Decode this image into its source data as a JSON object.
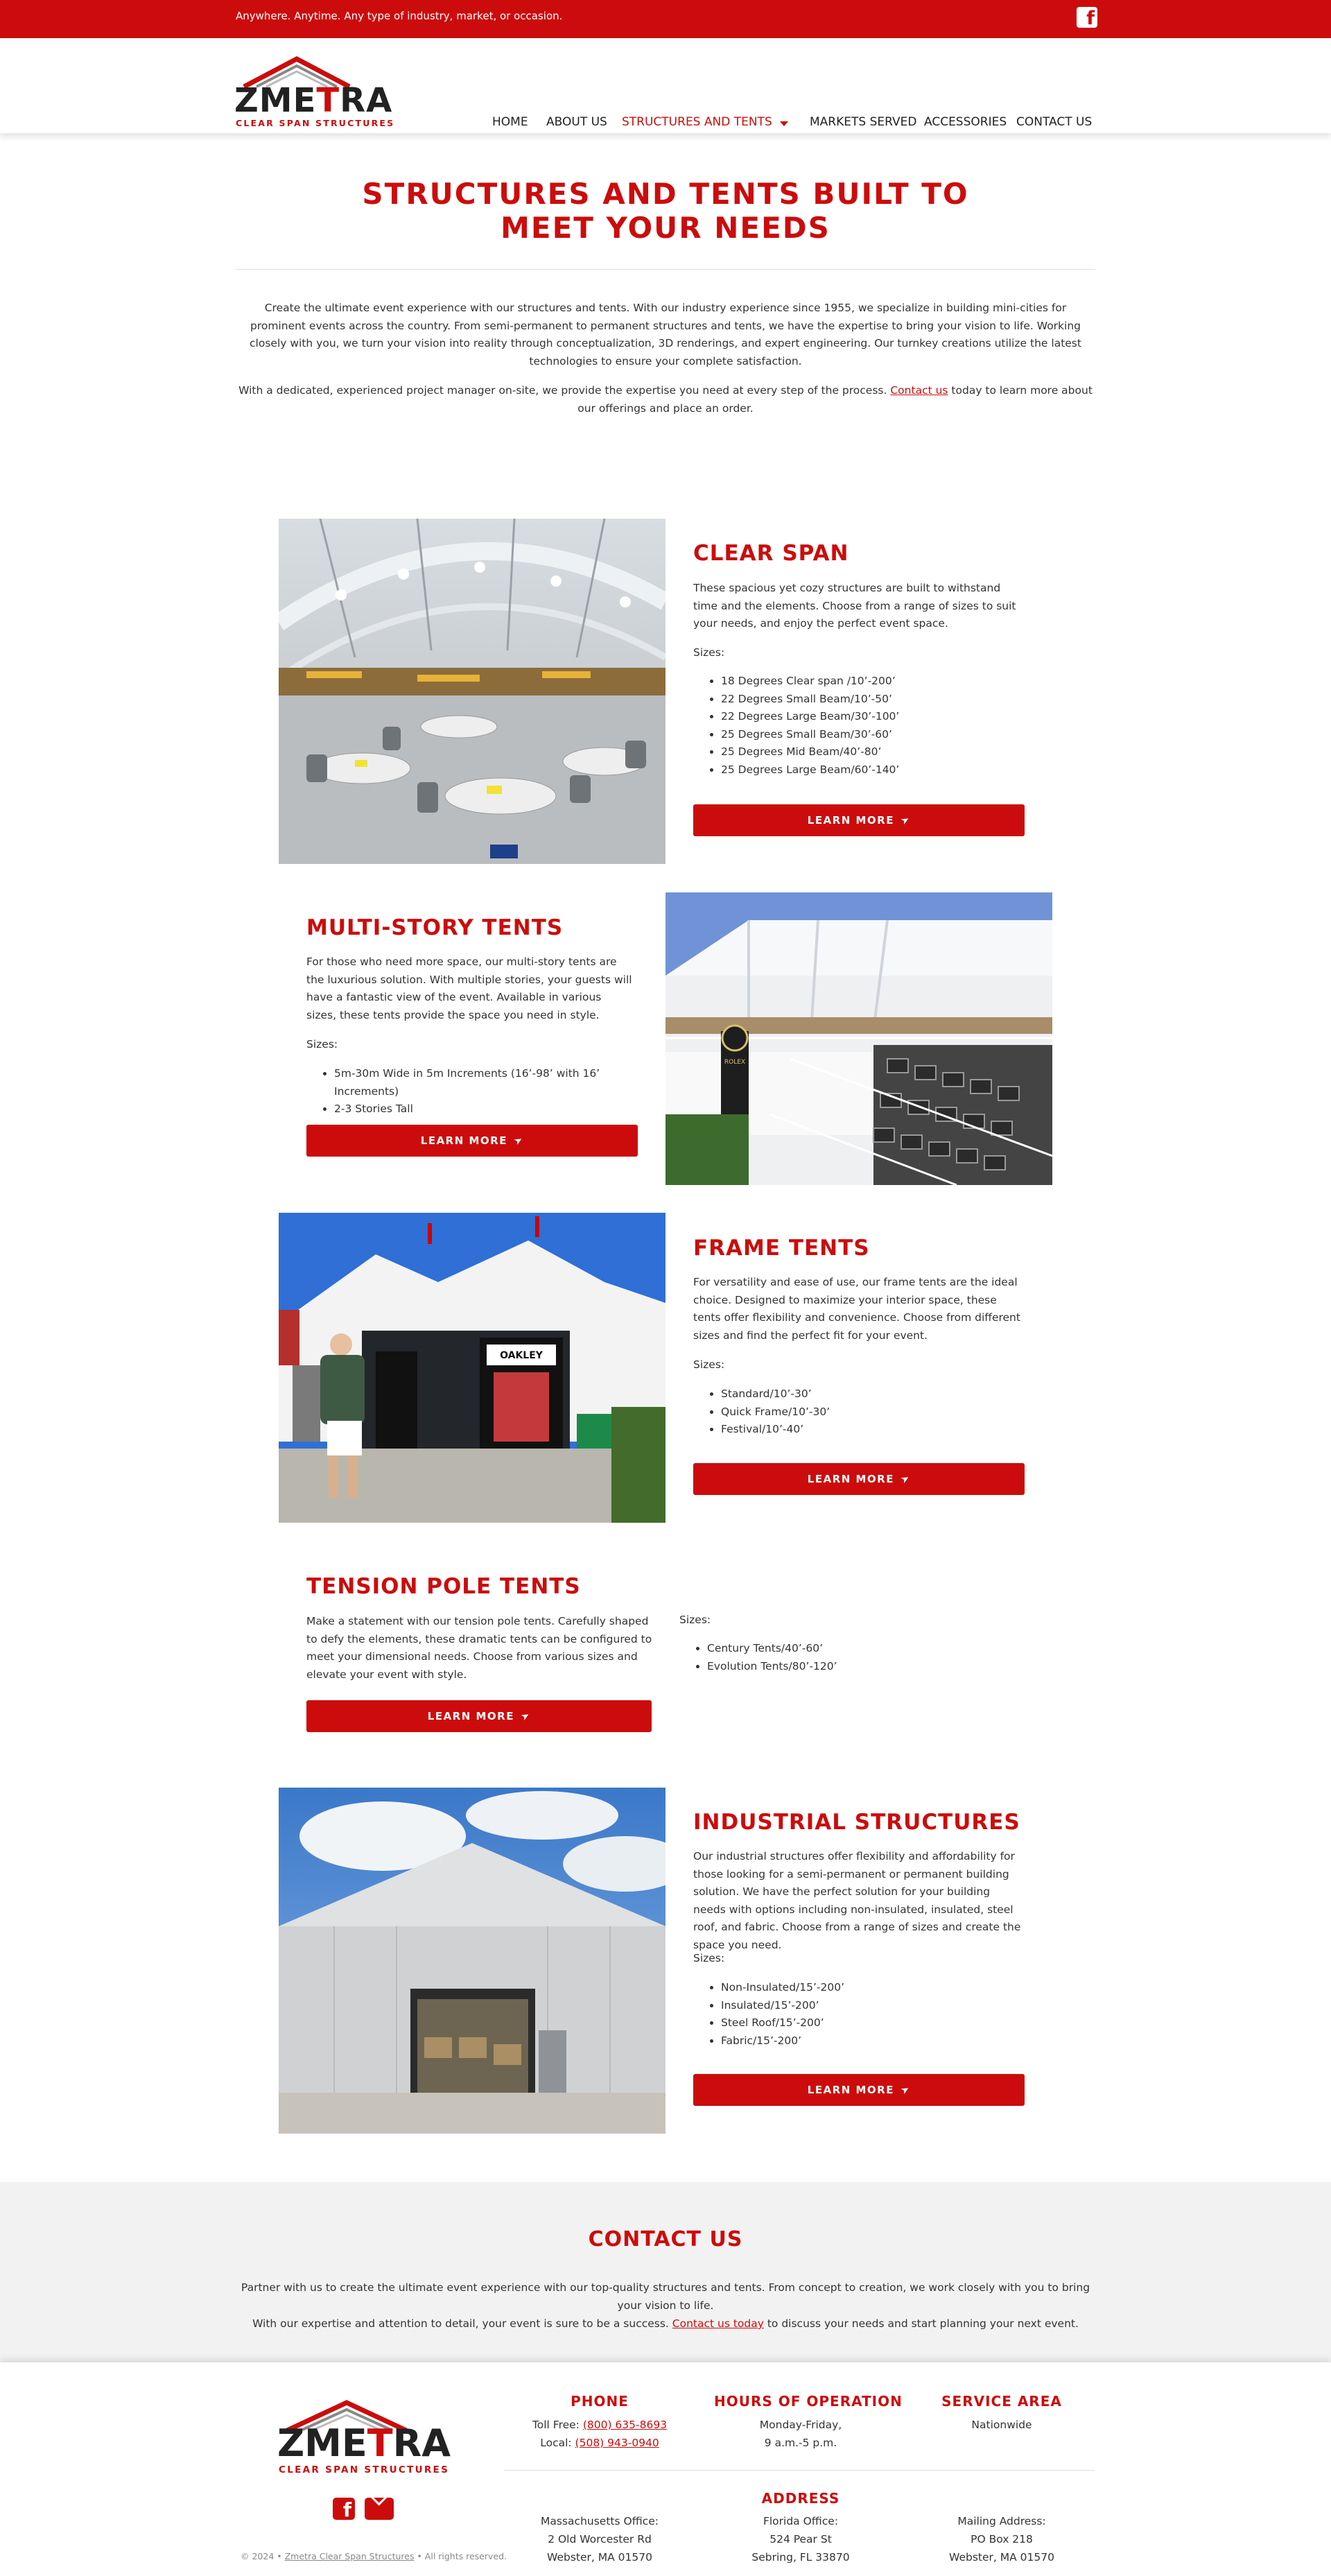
{
  "topbar": {
    "tagline": "Anywhere. Anytime. Any type of industry, market, or occasion.",
    "facebook_glyph": "f"
  },
  "logo": {
    "word_a": "ZME",
    "word_b": "T",
    "word_c": "RA",
    "subtitle": "CLEAR SPAN STRUCTURES"
  },
  "nav": {
    "home": "HOME",
    "about": "ABOUT US",
    "structures": "STRUCTURES AND TENTS",
    "markets": "MARKETS SERVED",
    "accessories": "ACCESSORIES",
    "contact": "CONTACT US"
  },
  "hero": {
    "title_line1": "STRUCTURES AND TENTS BUILT TO",
    "title_line2": "MEET YOUR NEEDS",
    "para1": "Create the ultimate event experience with our structures and tents. With our industry experience since 1955, we specialize in building mini-cities for prominent events across the country. From semi-permanent to permanent structures and tents, we have the expertise to bring your vision to life. Working closely with you, we turn your vision into reality through conceptualization, 3D renderings, and expert engineering. Our turnkey creations utilize the latest technologies to ensure your complete satisfaction.",
    "para2_before": "With a dedicated, experienced project manager on-site, we provide the expertise you need at every step of the process. ",
    "para2_link": "Contact us",
    "para2_after": " today to learn more about our offerings and place an order."
  },
  "sections": {
    "sizes_label": "Sizes:",
    "learn_more": "LEARN MORE",
    "clear_span": {
      "title": "CLEAR SPAN",
      "desc": "These spacious yet cozy structures are built to withstand time and the elements. Choose from a range of sizes to suit your needs, and enjoy the perfect event space.",
      "sizes": [
        "18 Degrees Clear span /10’-200’",
        "22 Degrees Small Beam/10’-50’",
        "22 Degrees Large Beam/30’-100’",
        "25 Degrees Small Beam/30’-60’",
        "25 Degrees Mid Beam/40’-80’",
        "25 Degrees Large Beam/60’-140’"
      ]
    },
    "multi_story": {
      "title": "MULTI-STORY TENTS",
      "desc": "For those who need more space, our multi-story tents are the luxurious solution. With multiple stories, your guests will have a fantastic view of the event. Available in various sizes, these tents provide the space you need in style.",
      "sizes": [
        "5m-30m Wide in 5m Increments (16’-98’ with 16’ Increments)",
        "2-3 Stories Tall"
      ]
    },
    "frame": {
      "title": "FRAME TENTS",
      "desc": "For versatility and ease of use, our frame tents are the ideal choice. Designed to maximize your interior space, these tents offer flexibility and convenience. Choose from different sizes and find the perfect fit for your event.",
      "sizes": [
        "Standard/10’-30’",
        "Quick Frame/10’-30’",
        "Festival/10’-40’"
      ]
    },
    "tension": {
      "title": "TENSION POLE TENTS",
      "desc": "Make a statement with our tension pole tents. Carefully shaped to defy the elements, these dramatic tents can be configured to meet your dimensional needs. Choose from various sizes and elevate your event with style.",
      "sizes": [
        "Century Tents/40’-60’",
        "Evolution Tents/80’-120’"
      ]
    },
    "industrial": {
      "title": "INDUSTRIAL STRUCTURES",
      "desc": "Our industrial structures offer flexibility and affordability for those looking for a semi-permanent or permanent building solution. We have the perfect solution for your building needs with options including non-insulated, insulated, steel roof, and fabric. Choose from a range of sizes and create the space you need.",
      "sizes": [
        "Non-Insulated/15’-200’",
        "Insulated/15’-200’",
        "Steel Roof/15’-200’",
        "Fabric/15’-200’"
      ]
    },
    "photo_signs": {
      "oakley": "OAKLEY",
      "rolex": "ROLEX"
    }
  },
  "contact": {
    "title": "CONTACT US",
    "line1": "Partner with us to create the ultimate event experience with our top-quality structures and tents. From concept to creation, we work closely with you to bring your vision to life.",
    "line2_before": "With our expertise and attention to detail, your event is sure to be a success. ",
    "line2_link": "Contact us today",
    "line2_after": " to discuss your needs and start planning your next event."
  },
  "footer": {
    "phone_title": "PHONE",
    "tollfree_label": "Toll Free: ",
    "tollfree": "(800) 635-8693",
    "local_label": "Local: ",
    "local": "(508) 943-0940",
    "hours_title": "HOURS OF OPERATION",
    "hours_line1": "Monday-Friday,",
    "hours_line2": "9 a.m.-5 p.m.",
    "area_title": "SERVICE AREA",
    "area": "Nationwide",
    "address_title": "ADDRESS",
    "ma_label": "Massachusetts Office:",
    "ma_street": "2 Old Worcester Rd",
    "ma_city": "Webster, MA 01570",
    "fl_label": "Florida Office:",
    "fl_street": "524 Pear St",
    "fl_city": "Sebring, FL 33870",
    "mail_label": "Mailing Address:",
    "mail_street": "PO Box 218",
    "mail_city": "Webster, MA 01570",
    "copy_before": "© 2024 • ",
    "copy_link": "Zmetra Clear Span Structures",
    "copy_after": " • All rights reserved."
  },
  "colors": {
    "brand_red": "#cc0c0c",
    "band_gray": "#f2f2f2"
  }
}
